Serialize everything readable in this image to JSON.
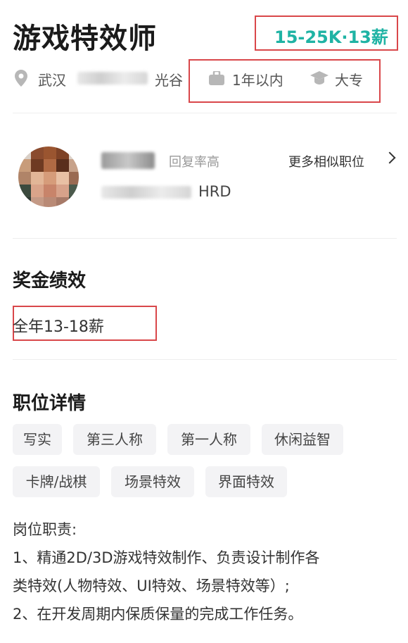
{
  "job": {
    "title": "游戏特效师",
    "salary": "15-25K·13薪"
  },
  "meta": {
    "city": "武汉",
    "district": "光谷",
    "experience": "1年以内",
    "education": "大专",
    "icons": [
      "location-pin-icon",
      "briefcase-icon",
      "graduation-cap-icon"
    ]
  },
  "recruiter": {
    "reply_note": "回复率高",
    "role": "HRD",
    "more_label": "更多相似职位"
  },
  "bonus": {
    "section_title": "奖金绩效",
    "value": "全年13-18薪"
  },
  "details": {
    "section_title": "职位详情",
    "tags": [
      "写实",
      "第三人称",
      "第一人称",
      "休闲益智",
      "卡牌/战棋",
      "场景特效",
      "界面特效"
    ],
    "description_lines": [
      "岗位职责:",
      "1、精通2D/3D游戏特效制作、负责设计制作各",
      "类特效(人物特效、UI特效、场景特效等）;",
      "2、在开发周期内保质保量的完成工作任务。"
    ]
  },
  "colors": {
    "salary": "#1fb3a4",
    "highlight_box": "#d9474a",
    "tag_bg": "#f3f3f5"
  }
}
